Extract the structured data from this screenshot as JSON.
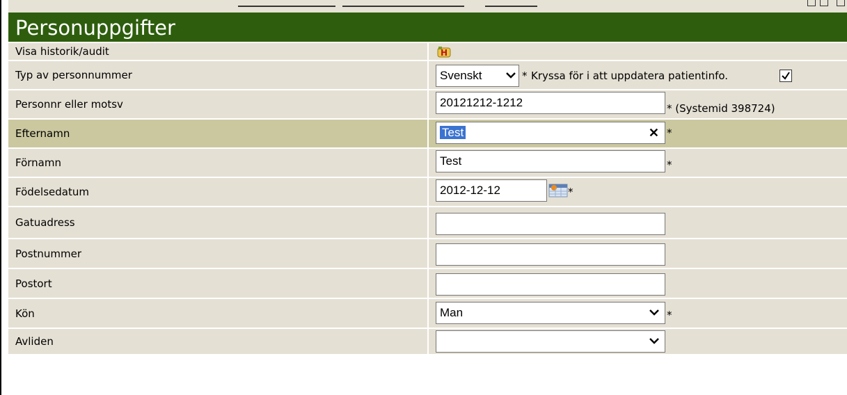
{
  "page": {
    "title": "Personuppgifter"
  },
  "rows": {
    "history": {
      "label": "Visa historik/audit",
      "icon": "history-audit-icon"
    },
    "id_type": {
      "label": "Typ av personnummer",
      "selected": "Svenskt",
      "star": "*",
      "update_text": "Kryssa för i att uppdatera patientinfo.",
      "update_checked": true
    },
    "personnr": {
      "label": "Personnr eller motsv",
      "value": "20121212-1212",
      "note": "* (Systemid 398724)"
    },
    "efternamn": {
      "label": "Efternamn",
      "value": "Test",
      "star": "*"
    },
    "fornamn": {
      "label": "Förnamn",
      "value": "Test",
      "star": "*"
    },
    "fodelsedatum": {
      "label": "Födelsedatum",
      "value": "2012-12-12",
      "star": "*"
    },
    "gatuadress": {
      "label": "Gatuadress",
      "value": ""
    },
    "postnummer": {
      "label": "Postnummer",
      "value": ""
    },
    "postort": {
      "label": "Postort",
      "value": ""
    },
    "kon": {
      "label": "Kön",
      "selected": "Man",
      "star": "*"
    },
    "avliden": {
      "label": "Avliden",
      "selected": ""
    }
  },
  "colors": {
    "header": "#2e5e0d",
    "row": "#e5e0d4",
    "row_highlight": "#cbc8a0",
    "selection": "#3b73d1"
  }
}
